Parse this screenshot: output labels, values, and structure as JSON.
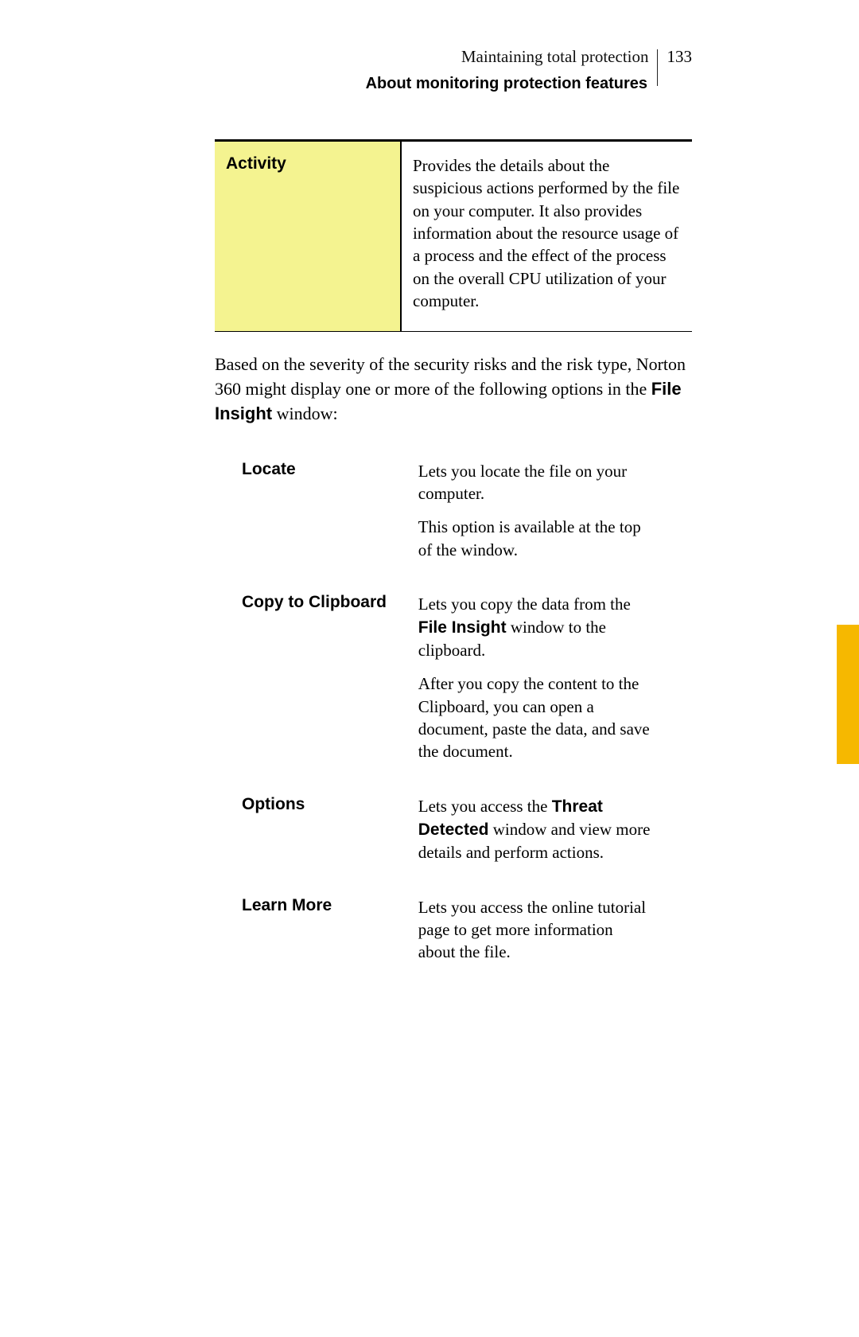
{
  "header": {
    "chapter": "Maintaining total protection",
    "page_number": "133",
    "section": "About monitoring protection features"
  },
  "activity_table": {
    "label": "Activity",
    "description": "Provides the details about the suspicious actions performed by the file on your computer. It also provides information about the resource usage of a process and the effect of the process on the overall CPU utilization of your computer."
  },
  "intro": {
    "pre": "Based on the severity of the security risks and the risk type, Norton 360 might display one or more of the following options in the ",
    "bold": "File Insight",
    "post": " window:"
  },
  "options": [
    {
      "label": "Locate",
      "paragraphs": [
        {
          "text": "Lets you locate the file on your computer."
        },
        {
          "text": "This option is available at the top of the window."
        }
      ]
    },
    {
      "label": "Copy to Clipboard",
      "paragraphs": [
        {
          "pre": "Lets you copy the data from the ",
          "bold": "File Insight",
          "post": " window to the clipboard."
        },
        {
          "text": "After you copy the content to the Clipboard, you can open a document, paste the data, and save the document."
        }
      ]
    },
    {
      "label": "Options",
      "paragraphs": [
        {
          "pre": "Lets you access the ",
          "bold": "Threat Detected",
          "post": "  window and view more details and perform actions."
        }
      ]
    },
    {
      "label": "Learn More",
      "paragraphs": [
        {
          "text": "Lets you access the online tutorial page to get more information about the file."
        }
      ]
    }
  ]
}
